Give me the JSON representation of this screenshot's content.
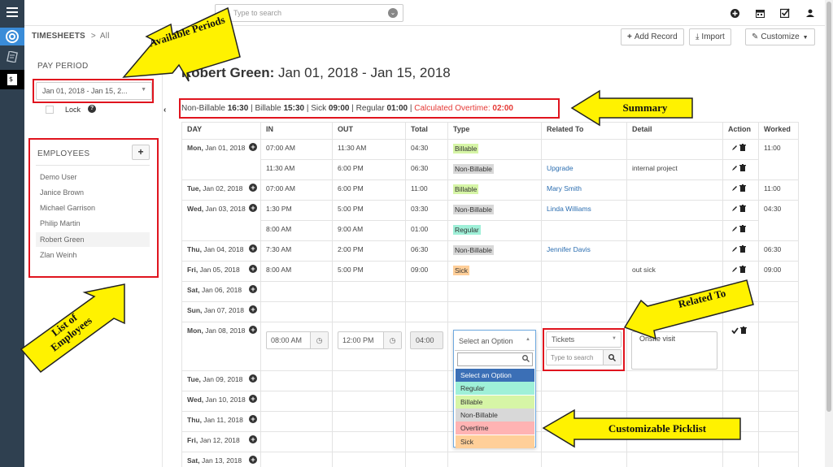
{
  "topbar": {
    "search_placeholder": "Type to search"
  },
  "breadcrumb": {
    "root": "TIMESHEETS",
    "sep": ">",
    "current": "All"
  },
  "toolbar": {
    "add_record": "Add Record",
    "import": "Import",
    "customize": "Customize"
  },
  "pay_period": {
    "label": "PAY PERIOD",
    "value": "Jan 01, 2018 - Jan 15, 2...",
    "lock_label": "Lock",
    "help": "?"
  },
  "employees": {
    "heading": "EMPLOYEES",
    "add": "+",
    "items": [
      "Demo User",
      "Janice Brown",
      "Michael Garrison",
      "Philip Martin",
      "Robert Green",
      "Zlan Weinh"
    ],
    "active": "Robert Green"
  },
  "page": {
    "name": "Robert Green:",
    "range": "Jan 01, 2018 - Jan 15, 2018"
  },
  "summary": {
    "nonbillable_label": "Non-Billable",
    "nonbillable": "16:30",
    "billable_label": "Billable",
    "billable": "15:30",
    "sick_label": "Sick",
    "sick": "09:00",
    "regular_label": "Regular",
    "regular": "01:00",
    "overtime_label": "Calculated Overtime:",
    "overtime": "02:00",
    "sep": "|"
  },
  "table": {
    "headers": [
      "DAY",
      "IN",
      "OUT",
      "Total",
      "Type",
      "Related To",
      "Detail",
      "Action",
      "Worked"
    ],
    "rows": [
      {
        "day": "Mon,",
        "date": "Jan 01, 2018",
        "in": "07:00 AM",
        "out": "11:30 AM",
        "total": "04:30",
        "type": "Billable",
        "related": "",
        "detail": "",
        "worked": "11:00"
      },
      {
        "day": "",
        "date": "",
        "in": "11:30 AM",
        "out": "6:00 PM",
        "total": "06:30",
        "type": "Non-Billable",
        "related": "Upgrade",
        "detail": "internal project",
        "worked": ""
      },
      {
        "day": "Tue,",
        "date": "Jan 02, 2018",
        "in": "07:00 AM",
        "out": "6:00 PM",
        "total": "11:00",
        "type": "Billable",
        "related": "Mary Smith",
        "detail": "",
        "worked": "11:00"
      },
      {
        "day": "Wed,",
        "date": "Jan 03, 2018",
        "in": "1:30 PM",
        "out": "5:00 PM",
        "total": "03:30",
        "type": "Non-Billable",
        "related": "Linda Williams",
        "detail": "",
        "worked": "04:30"
      },
      {
        "day": "",
        "date": "",
        "in": "8:00 AM",
        "out": "9:00 AM",
        "total": "01:00",
        "type": "Regular",
        "related": "",
        "detail": "",
        "worked": ""
      },
      {
        "day": "Thu,",
        "date": "Jan 04, 2018",
        "in": "7:30 AM",
        "out": "2:00 PM",
        "total": "06:30",
        "type": "Non-Billable",
        "related": "Jennifer Davis",
        "detail": "",
        "worked": "06:30"
      },
      {
        "day": "Fri,",
        "date": "Jan 05, 2018",
        "in": "8:00 AM",
        "out": "5:00 PM",
        "total": "09:00",
        "type": "Sick",
        "related": "",
        "detail": "out sick",
        "worked": "09:00"
      },
      {
        "day": "Sat,",
        "date": "Jan 06, 2018",
        "in": "",
        "out": "",
        "total": "",
        "type": "",
        "related": "",
        "detail": "",
        "worked": ""
      },
      {
        "day": "Sun,",
        "date": "Jan 07, 2018",
        "in": "",
        "out": "",
        "total": "",
        "type": "",
        "related": "",
        "detail": "",
        "worked": ""
      }
    ],
    "edit_row": {
      "day": "Mon,",
      "date": "Jan 08, 2018",
      "in": "08:00 AM",
      "out": "12:00 PM",
      "total": "04:00",
      "type_placeholder": "Select an Option",
      "related_module": "Tickets",
      "related_placeholder": "Type to search",
      "detail": "Onsite visit"
    },
    "after_rows": [
      {
        "day": "Tue,",
        "date": "Jan 09, 2018"
      },
      {
        "day": "Wed,",
        "date": "Jan 10, 2018"
      },
      {
        "day": "Thu,",
        "date": "Jan 11, 2018"
      },
      {
        "day": "Fri,",
        "date": "Jan 12, 2018"
      },
      {
        "day": "Sat,",
        "date": "Jan 13, 2018"
      }
    ]
  },
  "picklist": {
    "options": [
      {
        "label": "Select an Option",
        "color": "#3b6fb6"
      },
      {
        "label": "Regular",
        "color": "#9ff0d8"
      },
      {
        "label": "Billable",
        "color": "#d6f5a6"
      },
      {
        "label": "Non-Billable",
        "color": "#d8d8d8"
      },
      {
        "label": "Overtime",
        "color": "#ffb3b3"
      },
      {
        "label": "Sick",
        "color": "#ffcf99"
      }
    ]
  },
  "type_colors": {
    "Billable": "#d6f5a6",
    "Non-Billable": "#d8d8d8",
    "Regular": "#9ff0d8",
    "Sick": "#ffcf99"
  },
  "annotations": {
    "periods": "Available Periods",
    "summary": "Summary",
    "related": "Related To",
    "employees": "List of Employees",
    "picklist": "Customizable Picklist"
  },
  "icons": [
    "menu-icon",
    "lifebuoy-icon",
    "notes-icon",
    "timesheet-icon",
    "plus-circle-icon",
    "calendar-icon",
    "checkbox-icon",
    "user-icon",
    "clock-icon",
    "search-icon",
    "pencil-icon",
    "trash-icon",
    "check-icon",
    "download-icon",
    "wrench-icon"
  ]
}
